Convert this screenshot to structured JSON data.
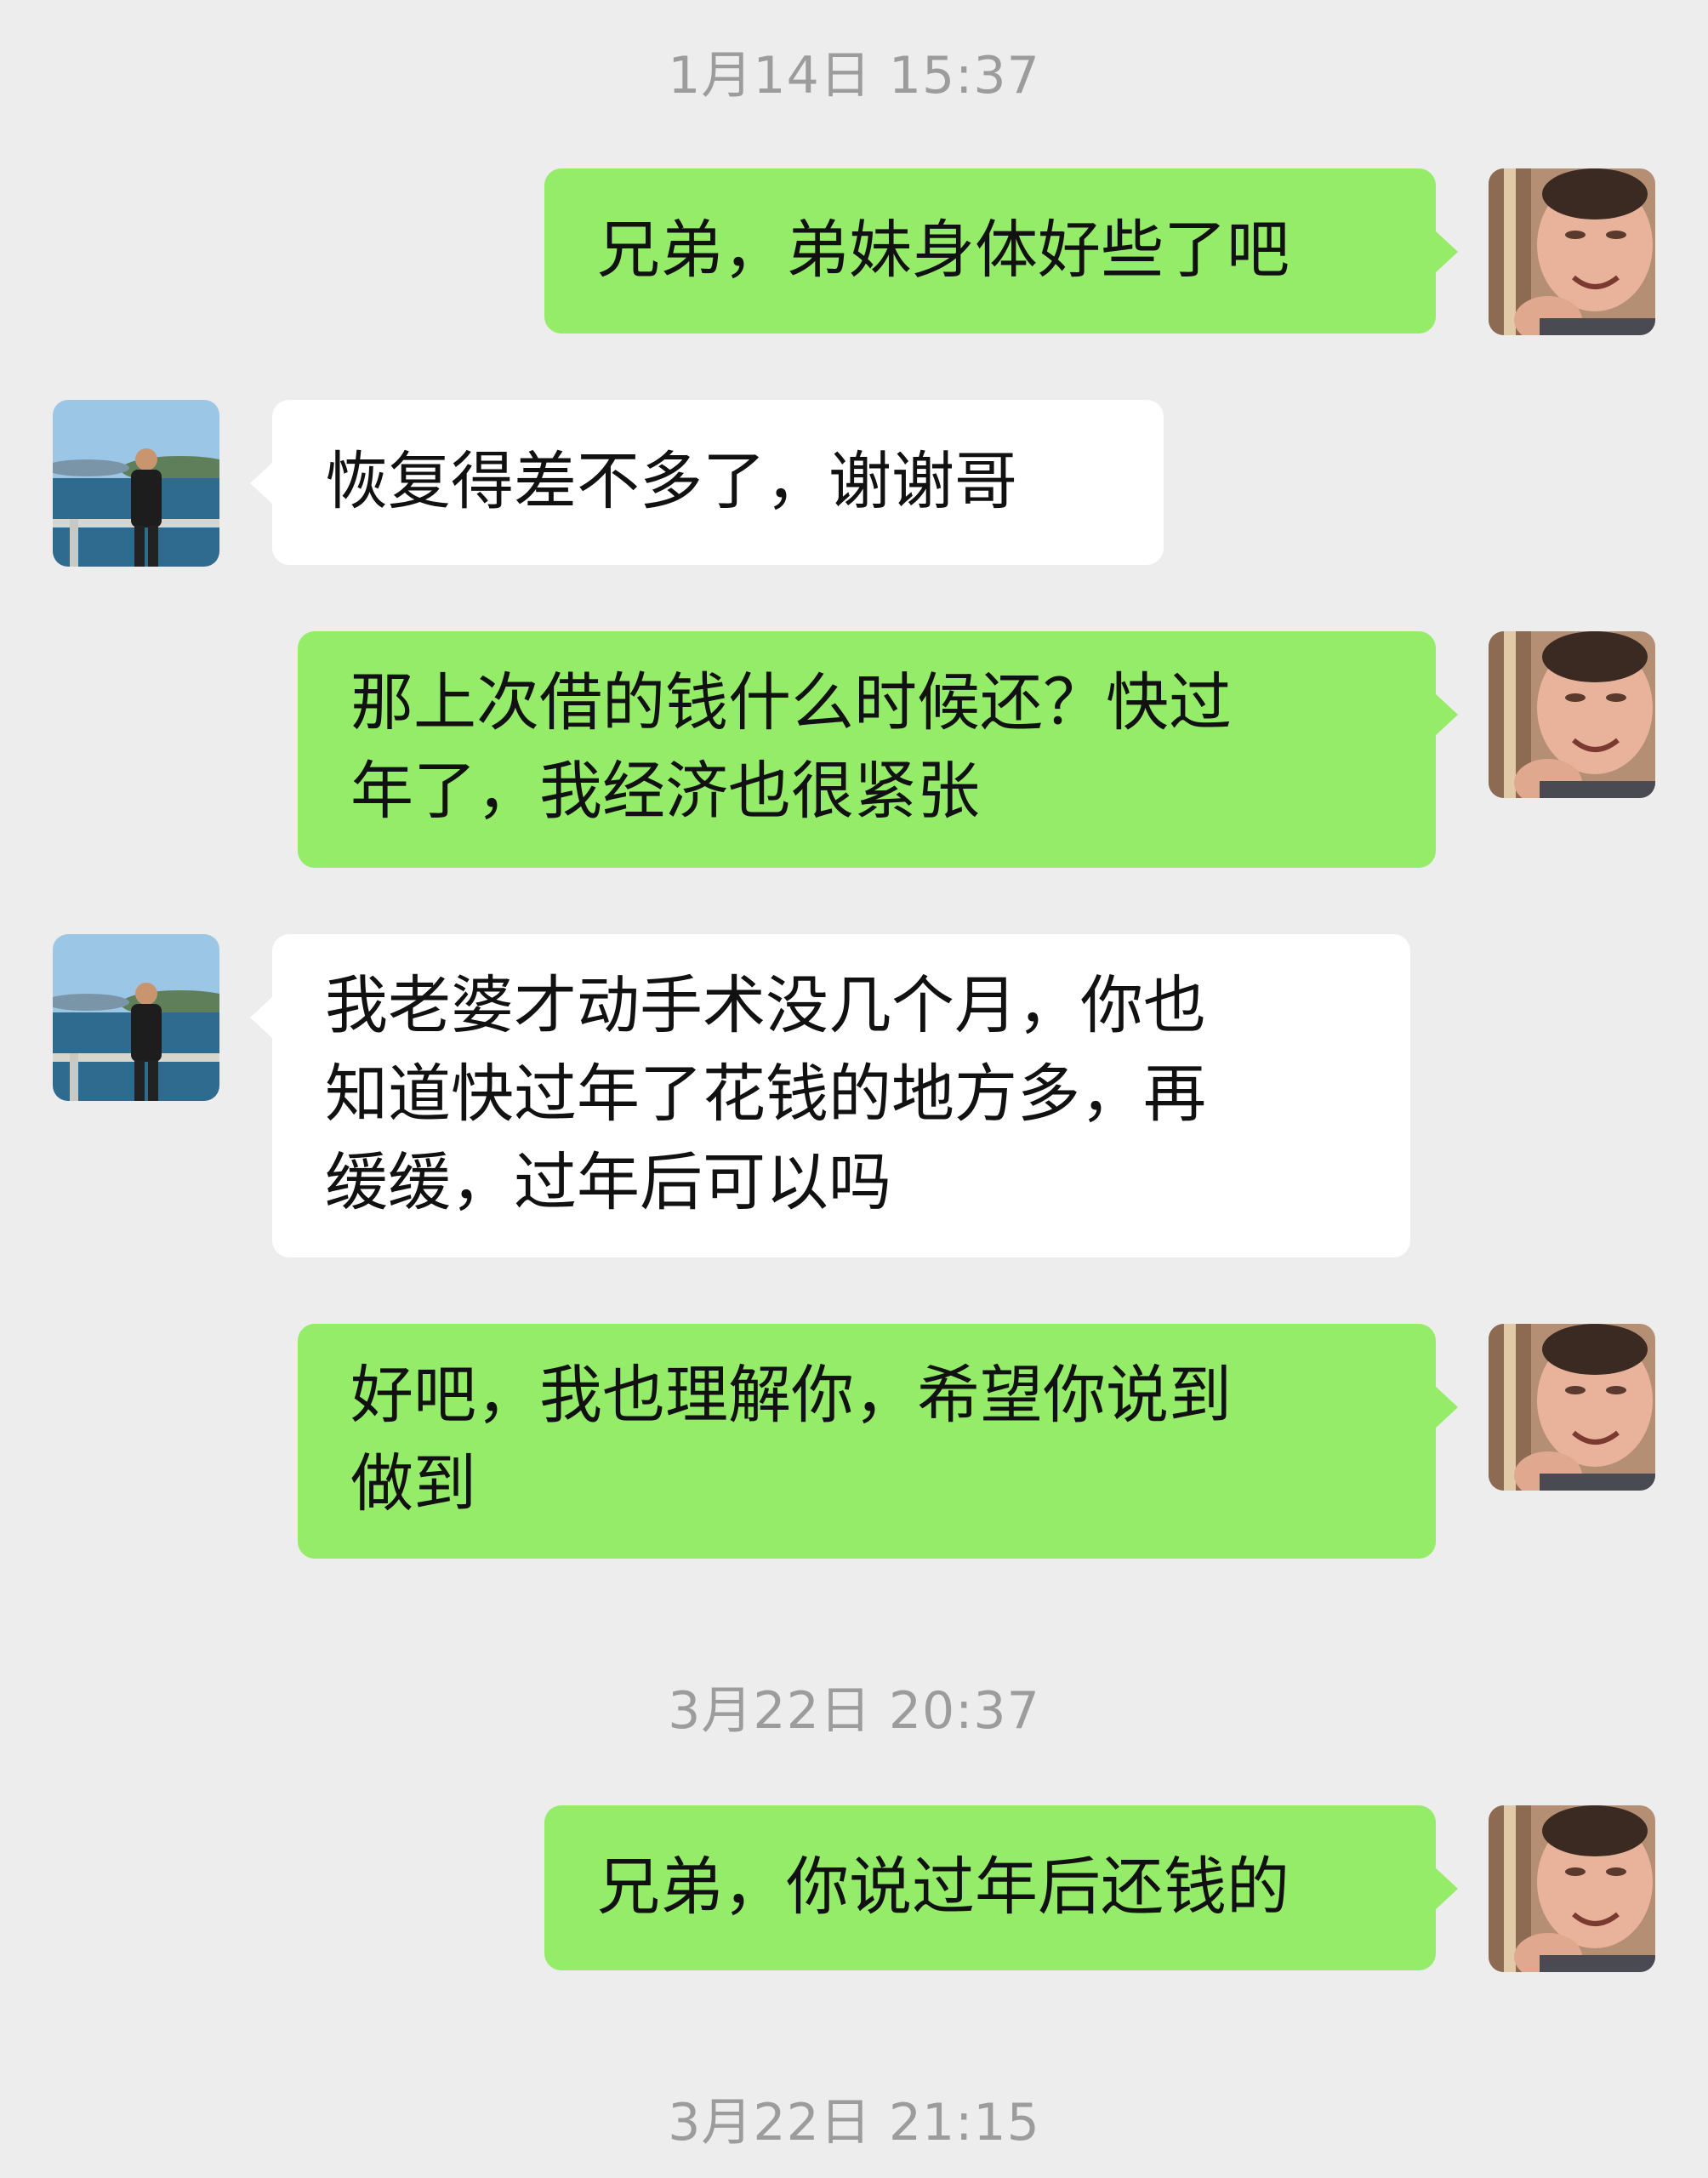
{
  "chat": {
    "timestamps": [
      "1月14日 15:37",
      "3月22日 20:37",
      "3月22日 21:15"
    ],
    "messages": [
      {
        "sender": "me",
        "lines": [
          "兄弟，弟妹身体好些了吧"
        ]
      },
      {
        "sender": "other",
        "lines": [
          "恢复得差不多了，谢谢哥"
        ]
      },
      {
        "sender": "me",
        "lines": [
          "那上次借的钱什么时候还？快过",
          "年了，我经济也很紧张"
        ]
      },
      {
        "sender": "other",
        "lines": [
          "我老婆才动手术没几个月，你也",
          "知道快过年了花钱的地方多，再",
          "缓缓，过年后可以吗"
        ]
      },
      {
        "sender": "me",
        "lines": [
          "好吧，我也理解你，希望你说到",
          "做到"
        ]
      },
      {
        "sender": "me",
        "lines": [
          "兄弟，你说过年后还钱的"
        ]
      }
    ]
  },
  "colors": {
    "background": "#ededed",
    "my_bubble": "#95ec69",
    "other_bubble": "#ffffff",
    "timestamp_text": "#9c9c9c"
  },
  "icons": {
    "my_avatar": "avatar-photo-man-selfie",
    "other_avatar": "avatar-photo-man-by-lake"
  }
}
